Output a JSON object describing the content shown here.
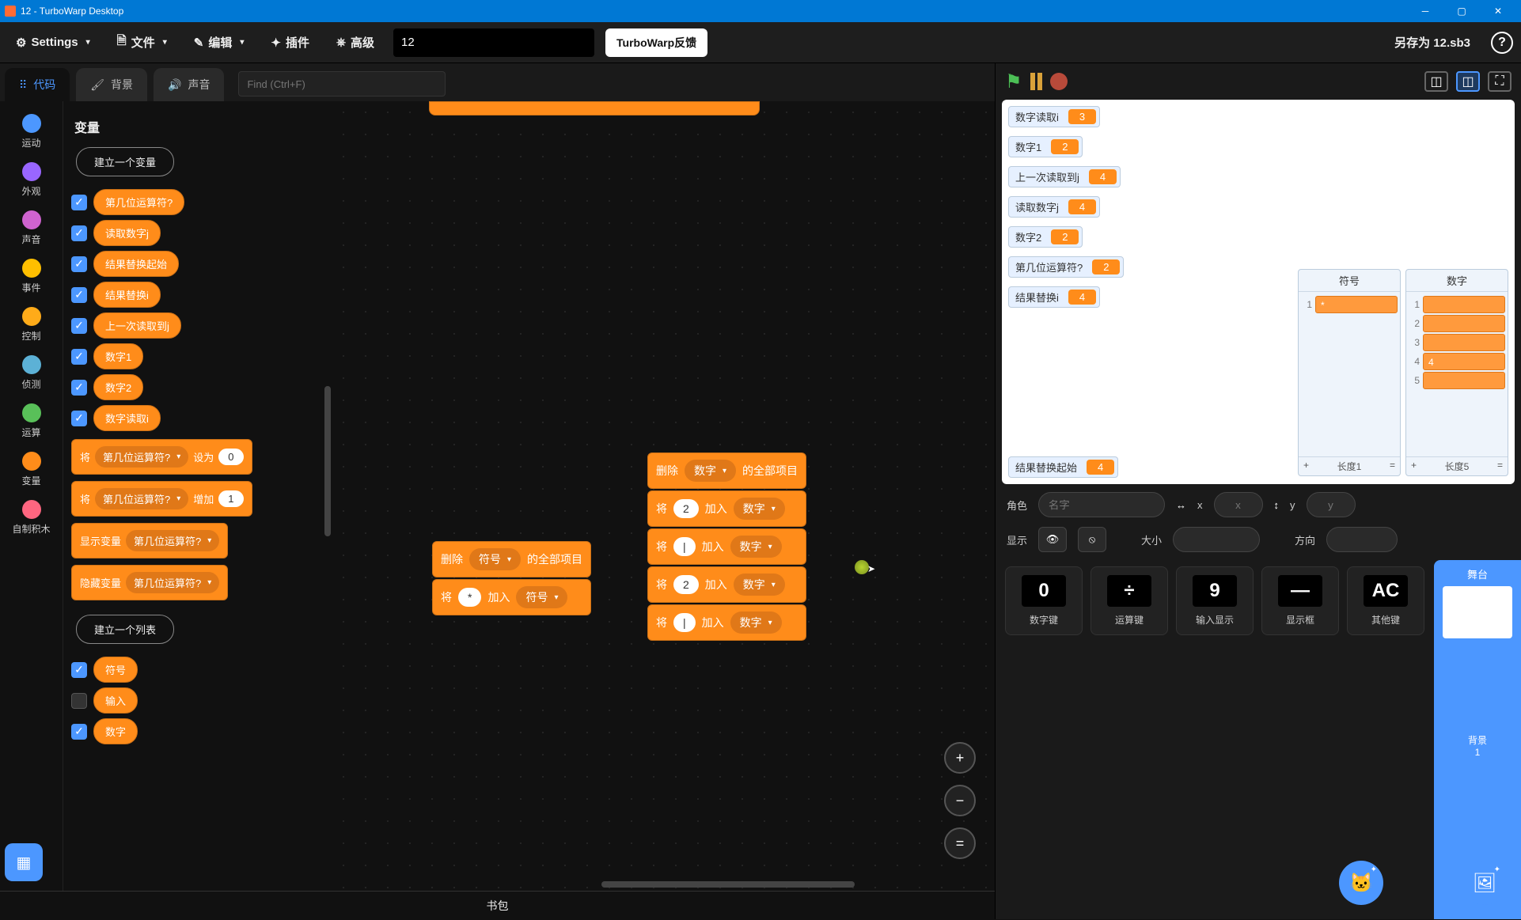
{
  "window": {
    "title": "12 - TurboWarp Desktop"
  },
  "menu": {
    "settings": "Settings",
    "file": "文件",
    "edit": "编辑",
    "plugins": "插件",
    "advanced": "高级",
    "project_name": "12",
    "feedback": "TurboWarp反馈",
    "saveas": "另存为 12.sb3"
  },
  "tabs": {
    "code": "代码",
    "backdrops": "背景",
    "sounds": "声音",
    "find_placeholder": "Find (Ctrl+F)"
  },
  "categories": [
    {
      "label": "运动",
      "color": "#4c97ff"
    },
    {
      "label": "外观",
      "color": "#9966ff"
    },
    {
      "label": "声音",
      "color": "#cf63cf"
    },
    {
      "label": "事件",
      "color": "#ffbf00"
    },
    {
      "label": "控制",
      "color": "#ffab19"
    },
    {
      "label": "侦测",
      "color": "#5cb1d6"
    },
    {
      "label": "运算",
      "color": "#59c059"
    },
    {
      "label": "变量",
      "color": "#ff8c1a"
    },
    {
      "label": "自制积木",
      "color": "#ff6680"
    }
  ],
  "palette": {
    "header": "变量",
    "make_variable": "建立一个变量",
    "vars": [
      {
        "name": "第几位运算符?",
        "checked": true
      },
      {
        "name": "读取数字j",
        "checked": true
      },
      {
        "name": "结果替换起始",
        "checked": true
      },
      {
        "name": "结果替换i",
        "checked": true
      },
      {
        "name": "上一次读取到j",
        "checked": true
      },
      {
        "name": "数字1",
        "checked": true
      },
      {
        "name": "数字2",
        "checked": true
      },
      {
        "name": "数字读取i",
        "checked": true
      }
    ],
    "set_block": {
      "pre": "将",
      "var": "第几位运算符?",
      "mid": "设为",
      "val": "0"
    },
    "change_block": {
      "pre": "将",
      "var": "第几位运算符?",
      "mid": "增加",
      "val": "1"
    },
    "show_block": {
      "pre": "显示变量",
      "var": "第几位运算符?"
    },
    "hide_block": {
      "pre": "隐藏变量",
      "var": "第几位运算符?"
    },
    "make_list": "建立一个列表",
    "lists": [
      {
        "name": "符号",
        "checked": true
      },
      {
        "name": "输入",
        "checked": false
      },
      {
        "name": "数字",
        "checked": true
      }
    ]
  },
  "workspace": {
    "group1": {
      "delete": {
        "pre": "删除",
        "list": "符号",
        "post": "的全部项目"
      },
      "add1": {
        "pre": "将",
        "val": "*",
        "mid": "加入",
        "list": "符号"
      }
    },
    "group2": {
      "delete": {
        "pre": "删除",
        "list": "数字",
        "post": "的全部项目"
      },
      "rows": [
        {
          "pre": "将",
          "val": "2",
          "mid": "加入",
          "list": "数字"
        },
        {
          "pre": "将",
          "val": "|",
          "mid": "加入",
          "list": "数字"
        },
        {
          "pre": "将",
          "val": "2",
          "mid": "加入",
          "list": "数字"
        },
        {
          "pre": "将",
          "val": "|",
          "mid": "加入",
          "list": "数字"
        }
      ]
    }
  },
  "backpack": "书包",
  "stage": {
    "monitors": [
      {
        "label": "数字读取i",
        "value": "3"
      },
      {
        "label": "数字1",
        "value": "2"
      },
      {
        "label": "上一次读取到j",
        "value": "4"
      },
      {
        "label": "读取数字j",
        "value": "4"
      },
      {
        "label": "数字2",
        "value": "2"
      },
      {
        "label": "第几位运算符?",
        "value": "2"
      },
      {
        "label": "结果替换i",
        "value": "4"
      }
    ],
    "monitor_bottom": {
      "label": "结果替换起始",
      "value": "4"
    },
    "list1": {
      "title": "符号",
      "rows": [
        {
          "idx": "1",
          "val": "*"
        }
      ],
      "len_label": "长度1",
      "plus": "+",
      "eq": "="
    },
    "list2": {
      "title": "数字",
      "rows": [
        {
          "idx": "1",
          "val": ""
        },
        {
          "idx": "2",
          "val": ""
        },
        {
          "idx": "3",
          "val": ""
        },
        {
          "idx": "4",
          "val": "4"
        },
        {
          "idx": "5",
          "val": ""
        }
      ],
      "len_label": "长度5",
      "plus": "+",
      "eq": "="
    }
  },
  "sprite": {
    "label_sprite": "角色",
    "name_placeholder": "名字",
    "label_x": "x",
    "x_placeholder": "x",
    "label_y": "y",
    "y_placeholder": "y",
    "label_show": "显示",
    "label_size": "大小",
    "label_dir": "方向"
  },
  "sprites": [
    {
      "glyph": "0",
      "label": "数字键"
    },
    {
      "glyph": "÷",
      "label": "运算键"
    },
    {
      "glyph": "9",
      "label": "输入显示"
    },
    {
      "glyph": "—",
      "label": "显示框"
    },
    {
      "glyph": "AC",
      "label": "其他键"
    }
  ],
  "stagepanel": {
    "label": "舞台",
    "bg_label": "背景",
    "bg_count": "1"
  }
}
